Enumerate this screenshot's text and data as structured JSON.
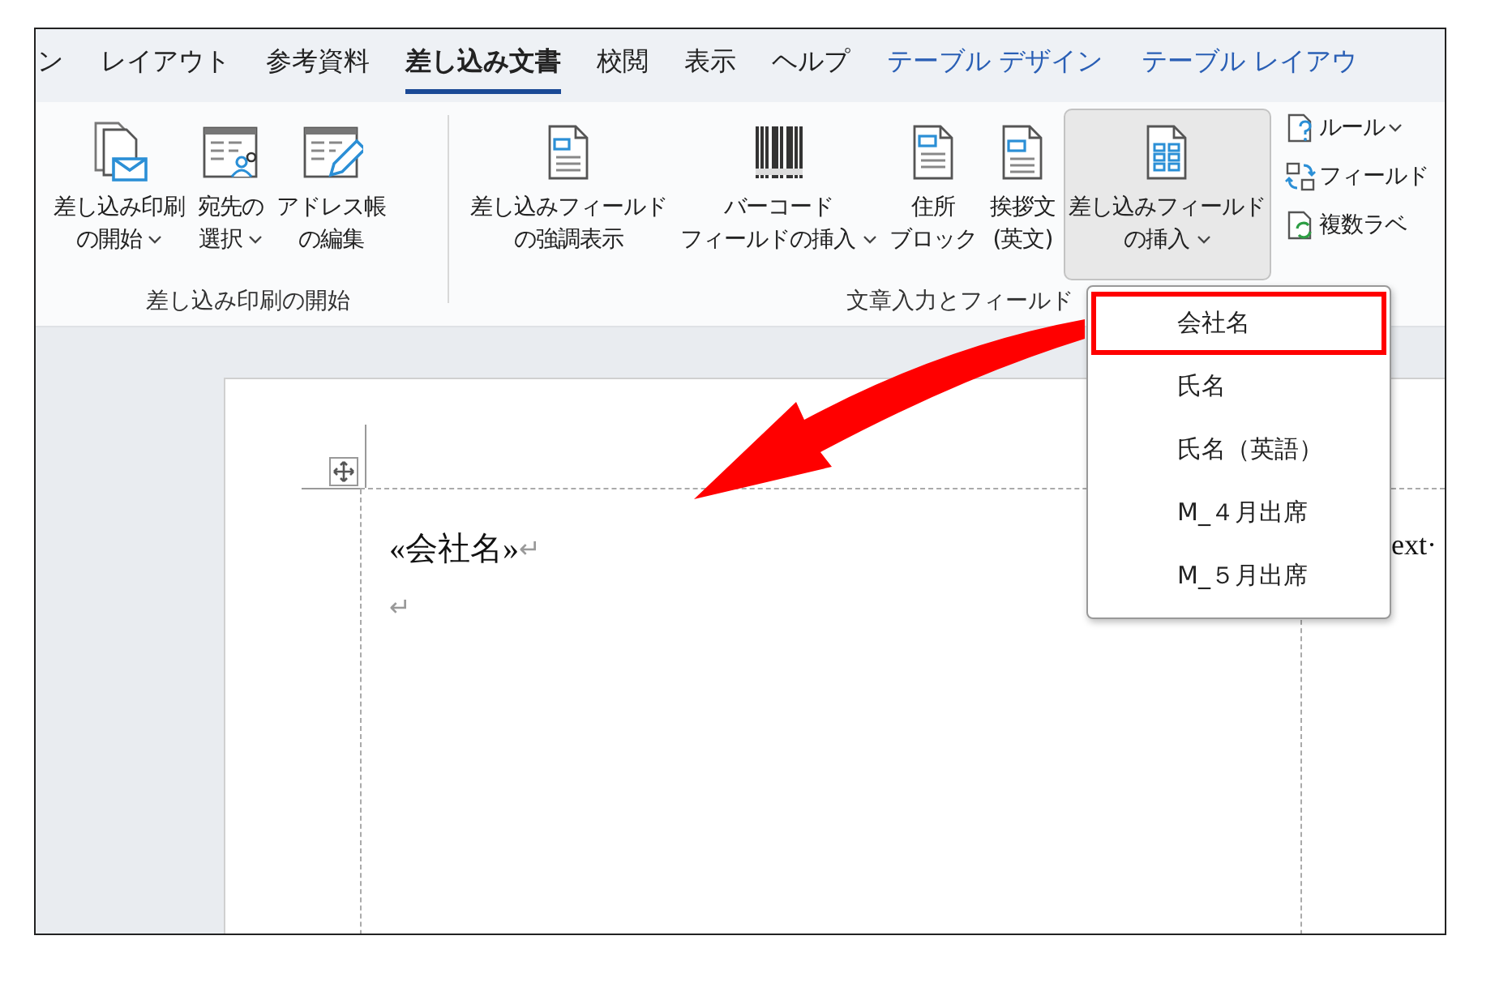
{
  "tabs": [
    {
      "label": "ン",
      "selected": false,
      "kind": "normal"
    },
    {
      "label": "レイアウト",
      "selected": false,
      "kind": "normal"
    },
    {
      "label": "参考資料",
      "selected": false,
      "kind": "normal"
    },
    {
      "label": "差し込み文書",
      "selected": true,
      "kind": "normal"
    },
    {
      "label": "校閲",
      "selected": false,
      "kind": "normal"
    },
    {
      "label": "表示",
      "selected": false,
      "kind": "normal"
    },
    {
      "label": "ヘルプ",
      "selected": false,
      "kind": "normal"
    },
    {
      "label": "テーブル デザイン",
      "selected": false,
      "kind": "context"
    },
    {
      "label": "テーブル レイアウ",
      "selected": false,
      "kind": "context"
    }
  ],
  "ribbon": {
    "groups": [
      {
        "label": "差し込み印刷の開始",
        "buttons": [
          {
            "lines": [
              "差し込み印刷",
              "の開始"
            ],
            "dropdown": true,
            "pressed": false
          },
          {
            "lines": [
              "宛先の",
              "選択"
            ],
            "dropdown": true,
            "pressed": false
          },
          {
            "lines": [
              "アドレス帳",
              "の編集"
            ],
            "dropdown": false,
            "pressed": false
          }
        ]
      },
      {
        "label": "文章入力とフィールド",
        "buttons": [
          {
            "lines": [
              "差し込みフィールド",
              "の強調表示"
            ],
            "dropdown": false,
            "pressed": false
          },
          {
            "lines": [
              "バーコード",
              "フィールドの挿入"
            ],
            "dropdown": true,
            "pressed": false
          },
          {
            "lines": [
              "住所",
              "ブロック"
            ],
            "dropdown": false,
            "pressed": false
          },
          {
            "lines": [
              "挨拶文",
              "(英文)"
            ],
            "dropdown": false,
            "pressed": false
          },
          {
            "lines": [
              "差し込みフィールド",
              "の挿入"
            ],
            "dropdown": true,
            "pressed": true
          }
        ],
        "small_buttons": [
          {
            "label": "ルール",
            "dropdown": true
          },
          {
            "label": "フィールド",
            "dropdown": false
          },
          {
            "label": "複数ラベ",
            "dropdown": false
          }
        ]
      }
    ]
  },
  "menu": {
    "items": [
      {
        "label": "会社名",
        "selected": true
      },
      {
        "label": "氏名",
        "selected": false
      },
      {
        "label": "氏名（英語）",
        "selected": false
      },
      {
        "label": "M_４月出席",
        "selected": false
      },
      {
        "label": "M_５月出席",
        "selected": false
      }
    ]
  },
  "document": {
    "cell_1": [
      {
        "text": "«会社名»",
        "return_mark": "↵"
      },
      {
        "return_mark": "↵"
      }
    ],
    "cell_2_text": "ext·"
  }
}
